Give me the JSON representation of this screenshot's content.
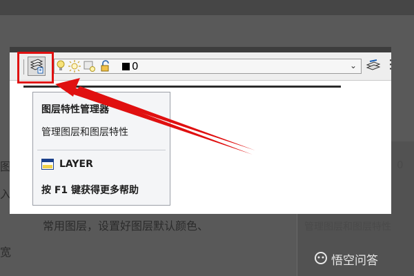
{
  "background": {
    "frag1": "图",
    "frag2": "入",
    "frag3": "常用图层，设置好图层默认颜色、",
    "frag4": "宽",
    "panel_text": "管理图层和图层特性",
    "panel_zero": "0"
  },
  "toolbar": {
    "layer_name": "0",
    "layer_button_icon": "layer-properties-icon",
    "state_icons": [
      "lightbulb-icon",
      "sun-icon",
      "viewport-freeze-icon",
      "unlock-icon"
    ],
    "color_swatch": "#000000"
  },
  "tooltip": {
    "title": "图层特性管理器",
    "description": "管理图层和图层特性",
    "command": "LAYER",
    "help": "按 F1 键获得更多帮助"
  },
  "annotation": {
    "color": "#e01010"
  },
  "watermark": {
    "text": "悟空问答"
  }
}
